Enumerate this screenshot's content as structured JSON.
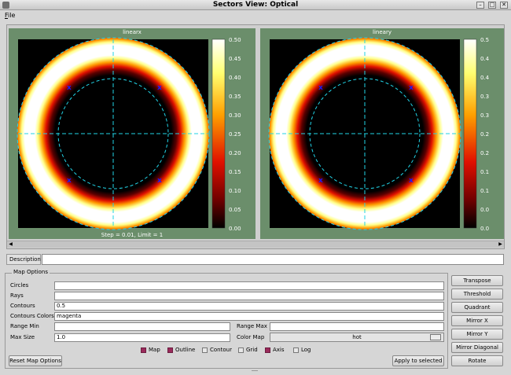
{
  "window": {
    "title": "Sectors View: Optical",
    "min": "–",
    "max": "□",
    "close": "✕"
  },
  "menu": {
    "file": "File"
  },
  "plots": [
    {
      "title": "linearx",
      "footer": "Step = 0.01, Limit = 1",
      "colorbar_ticks": [
        "0.50",
        "0.45",
        "0.40",
        "0.35",
        "0.30",
        "0.25",
        "0.20",
        "0.15",
        "0.10",
        "0.05",
        "0.00"
      ]
    },
    {
      "title": "lineary",
      "footer": "",
      "colorbar_ticks": [
        "0.5",
        "0.4",
        "0.4",
        "0.3",
        "0.3",
        "0.2",
        "0.2",
        "0.1",
        "0.1",
        "0.0",
        "0.0"
      ]
    }
  ],
  "colors": {
    "panel_bg": "#6b8e6b",
    "contour": "#22d3e6",
    "marker": "#1a1aff",
    "checkbox_on": "#9a2a5b"
  },
  "description": {
    "label": "Description",
    "value": ""
  },
  "map_options": {
    "legend": "Map Options",
    "circles_label": "Circles",
    "circles_value": "",
    "rays_label": "Rays",
    "rays_value": "",
    "contours_label": "Contours",
    "contours_value": "0.5",
    "contour_colors_label": "Contours Colors",
    "contour_colors_value": "magenta",
    "range_min_label": "Range Min",
    "range_min_value": "",
    "range_max_label": "Range Max",
    "range_max_value": "",
    "max_size_label": "Max Size",
    "max_size_value": "1.0",
    "color_map_label": "Color Map",
    "color_map_value": "hot",
    "checkboxes": [
      {
        "label": "Map",
        "checked": true
      },
      {
        "label": "Outline",
        "checked": true
      },
      {
        "label": "Contour",
        "checked": false
      },
      {
        "label": "Grid",
        "checked": false
      },
      {
        "label": "Axis",
        "checked": true
      },
      {
        "label": "Log",
        "checked": false
      }
    ],
    "reset_label": "Reset Map Options",
    "apply_label": "Apply to selected"
  },
  "side_buttons": [
    "Transpose",
    "Threshold",
    "Quadrant",
    "Mirror X",
    "Mirror Y",
    "Mirror Diagonal",
    "Rotate"
  ]
}
